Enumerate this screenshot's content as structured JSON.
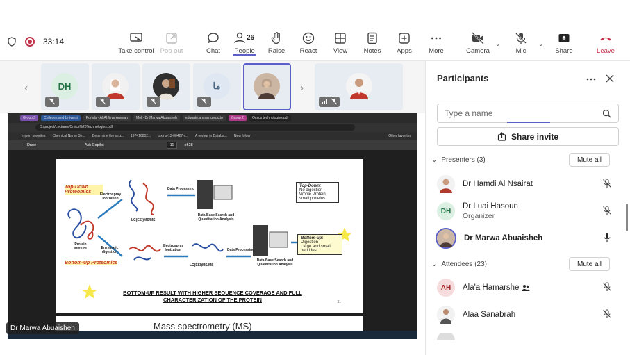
{
  "toolbar": {
    "timer": "33:14",
    "take_control": "Take control",
    "pop_out": "Pop out",
    "chat": "Chat",
    "people": "People",
    "people_count": "26",
    "raise": "Raise",
    "react": "React",
    "view": "View",
    "notes": "Notes",
    "apps": "Apps",
    "more": "More",
    "camera": "Camera",
    "mic": "Mic",
    "share": "Share",
    "leave": "Leave"
  },
  "strip": {
    "tiles": [
      {
        "initials": "DH",
        "avatar_bg": "#dcefe3",
        "avatar_fg": "#217346",
        "type": "initials"
      },
      {
        "type": "photo",
        "photo_bg": "#c0392b"
      },
      {
        "type": "photo",
        "photo_bg": "#3b3b3b"
      },
      {
        "initials": "ما",
        "avatar_bg": "#dfe8f2",
        "avatar_fg": "#4a6785",
        "type": "initials"
      },
      {
        "type": "photo",
        "photo_bg": "#b48a6a",
        "selected": true
      },
      {
        "type": "photo",
        "photo_bg": "#c0392b"
      }
    ]
  },
  "shared_screen": {
    "presenter_name": "Dr Marwa Abuaisheh",
    "browser_tabs": [
      "Group 3",
      "Colleges and Universi",
      "Portals · Al-Ahliyya Amman",
      "Mol · Dr Marwa Abuaisheh",
      "edugate.ammanu.edu.jo",
      "Group 2",
      "Omics technologies.pdf"
    ],
    "url": "D:/project/Lectures/Omics%20Technologies.pdf",
    "bookmarks": [
      "Import favorites",
      "Chemical Name Se...",
      "Determine the stru...",
      "197416802...",
      "toxins-13-00427-v...",
      "A review in Databa...",
      "New folder",
      "Other favorites"
    ],
    "pdf_tools": [
      "Draw",
      "Ask Copilot"
    ],
    "page_current": "11",
    "page_total": "of 28",
    "slide": {
      "top_down_label": "Top-Down Proteomics",
      "bottom_up_label": "Bottom-Up Proteomics",
      "electrospray": "Electrospray Ionization",
      "enzymatic": "Enzymatic digestion",
      "protein_mixture": "Protein Mixture",
      "data_processing": "Data Processing",
      "lcms": "LC(ESI)MS/MS",
      "db_search": "Data Base Search and Quantitation Analysis",
      "topdown_box_title": "Top-Down:",
      "topdown_items": [
        "No digestion",
        "Whole Protein",
        "small proteins."
      ],
      "bottomup_box_title": "Bottom-up:",
      "bottomup_items": [
        "Digestion",
        "Large and small peptides"
      ],
      "caption": "BOTTOM-UP RESULT WITH HIGHER SEQUENCE COVERAGE AND FULL CHARACTERIZATION OF THE PROTEIN",
      "page_no": "31",
      "next_title": "Mass spectrometry (MS)"
    }
  },
  "panel": {
    "title": "Participants",
    "search_placeholder": "Type a name",
    "share_invite": "Share invite",
    "presenters_label": "Presenters (3)",
    "attendees_label": "Attendees (23)",
    "mute_all": "Mute all",
    "presenters": [
      {
        "name": "Dr Hamdi Al Nsairat",
        "role": "",
        "avatar": "photo",
        "avatar_bg": "#b03a2e",
        "mic": "muted"
      },
      {
        "name": "Dr Luai Hasoun",
        "role": "Organizer",
        "avatar": "DH",
        "avatar_bg": "#dcefe3",
        "avatar_fg": "#217346",
        "mic": "muted"
      },
      {
        "name": "Dr Marwa Abuaisheh",
        "role": "",
        "avatar": "photo",
        "avatar_bg": "#b48a6a",
        "mic": "on",
        "bold": true
      }
    ],
    "attendees": [
      {
        "name": "Ala'a Hamarshe",
        "avatar": "AH",
        "avatar_bg": "#f6dcdc",
        "avatar_fg": "#a4262c",
        "mic": "muted",
        "badge": "people-icon"
      },
      {
        "name": "Alaa Sanabrah",
        "avatar": "photo",
        "avatar_bg": "#6b6b6b",
        "mic": "muted"
      }
    ]
  }
}
